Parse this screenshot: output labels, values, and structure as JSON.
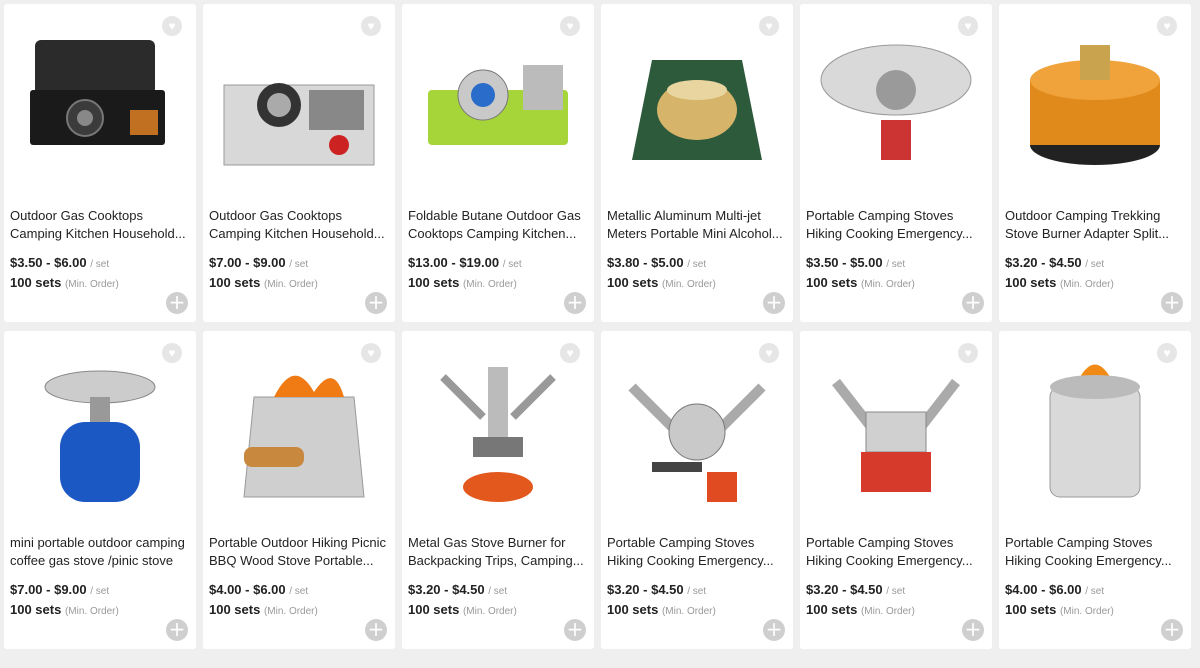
{
  "products": [
    {
      "title1": "Outdoor Gas Cooktops",
      "title2": "Camping Kitchen Household...",
      "price": "$3.50 - $6.00",
      "unit": "/ set",
      "moq": "100 sets",
      "moq_note": "(Min. Order)",
      "icon": "portable-stove-case-image"
    },
    {
      "title1": "Outdoor Gas Cooktops",
      "title2": "Camping Kitchen Household...",
      "price": "$7.00 - $9.00",
      "unit": "/ set",
      "moq": "100 sets",
      "moq_note": "(Min. Order)",
      "icon": "silver-cassette-stove-image"
    },
    {
      "title1": "Foldable Butane Outdoor Gas",
      "title2": "Cooktops Camping Kitchen...",
      "price": "$13.00 - $19.00",
      "unit": "/ set",
      "moq": "100 sets",
      "moq_note": "(Min. Order)",
      "icon": "green-mini-stove-image"
    },
    {
      "title1": "Metallic Aluminum Multi-jet",
      "title2": "Meters Portable Mini Alcohol...",
      "price": "$3.80 - $5.00",
      "unit": "/ set",
      "moq": "100 sets",
      "moq_note": "(Min. Order)",
      "icon": "alcohol-burner-image"
    },
    {
      "title1": "Portable Camping Stoves",
      "title2": "Hiking Cooking Emergency...",
      "price": "$3.50 - $5.00",
      "unit": "/ set",
      "moq": "100 sets",
      "moq_note": "(Min. Order)",
      "icon": "windshield-stove-image"
    },
    {
      "title1": "Outdoor Camping Trekking",
      "title2": "Stove Burner Adapter Split...",
      "price": "$3.20 - $4.50",
      "unit": "/ set",
      "moq": "100 sets",
      "moq_note": "(Min. Order)",
      "icon": "orange-adapter-image"
    },
    {
      "title1": "mini portable outdoor camping",
      "title2": "coffee gas stove /pinic stove",
      "price": "$7.00 - $9.00",
      "unit": "/ set",
      "moq": "100 sets",
      "moq_note": "(Min. Order)",
      "icon": "blue-canister-stove-image"
    },
    {
      "title1": "Portable Outdoor Hiking Picnic",
      "title2": "BBQ Wood Stove Portable...",
      "price": "$4.00 - $6.00",
      "unit": "/ set",
      "moq": "100 sets",
      "moq_note": "(Min. Order)",
      "icon": "wood-stove-image"
    },
    {
      "title1": "Metal Gas Stove Burner for",
      "title2": "Backpacking Trips, Camping...",
      "price": "$3.20 - $4.50",
      "unit": "/ set",
      "moq": "100 sets",
      "moq_note": "(Min. Order)",
      "icon": "backpacking-burner-image"
    },
    {
      "title1": "Portable Camping Stoves",
      "title2": "Hiking Cooking Emergency...",
      "price": "$3.20 - $4.50",
      "unit": "/ set",
      "moq": "100 sets",
      "moq_note": "(Min. Order)",
      "icon": "split-stove-image"
    },
    {
      "title1": "Portable Camping Stoves",
      "title2": "Hiking Cooking Emergency...",
      "price": "$3.20 - $4.50",
      "unit": "/ set",
      "moq": "100 sets",
      "moq_note": "(Min. Order)",
      "icon": "square-red-stove-image"
    },
    {
      "title1": "Portable Camping Stoves",
      "title2": "Hiking Cooking Emergency...",
      "price": "$4.00 - $6.00",
      "unit": "/ set",
      "moq": "100 sets",
      "moq_note": "(Min. Order)",
      "icon": "steel-wood-stove-image"
    }
  ],
  "icons": {
    "favorite": "heart-icon",
    "add": "plus-icon"
  },
  "colors": {
    "background": "#efefef",
    "card": "#ffffff",
    "muted": "#999999",
    "add_button": "#cfcfcf"
  }
}
